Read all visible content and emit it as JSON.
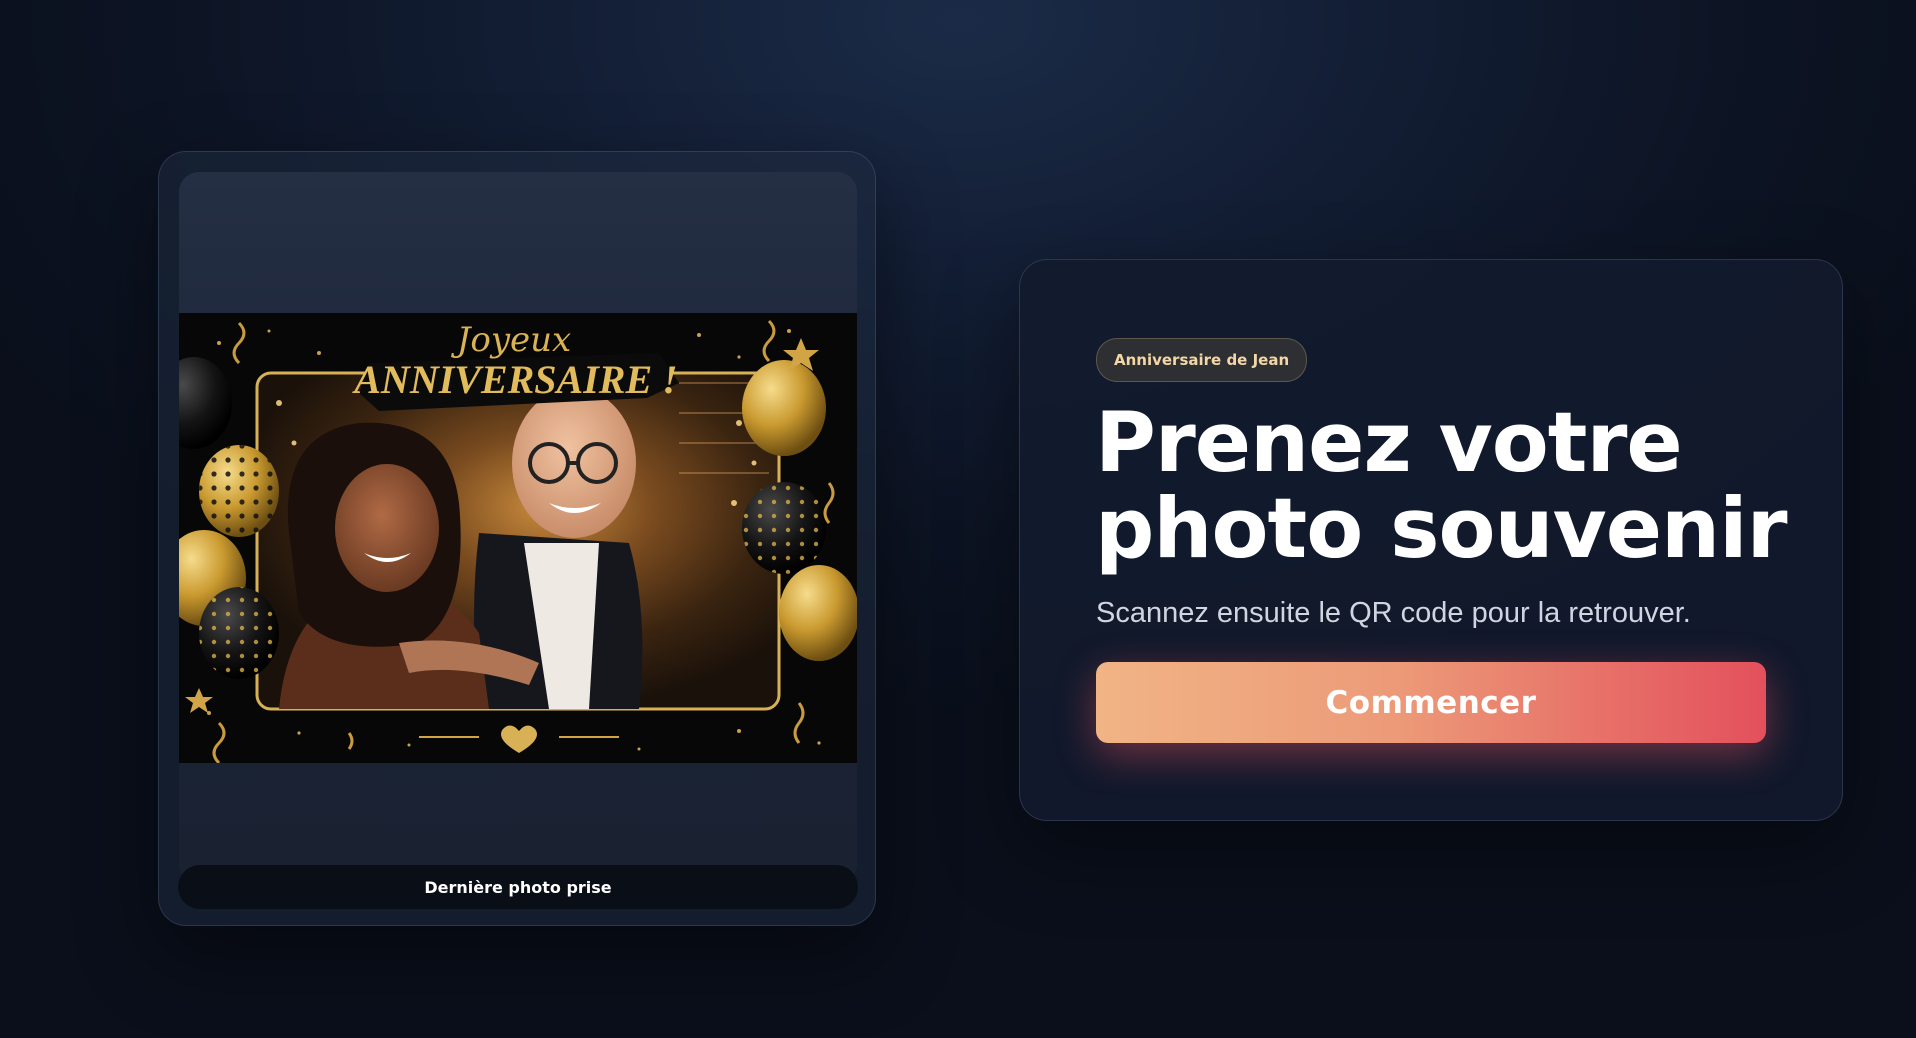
{
  "preview": {
    "photo_overlay_line1": "Joyeux",
    "photo_overlay_line2": "ANNIVERSAIRE !",
    "caption": "Dernière photo prise"
  },
  "intro": {
    "event_badge": "Anniversaire de Jean",
    "headline_line1": "Prenez votre",
    "headline_line2": "photo souvenir",
    "subtitle": "Scannez ensuite le QR code pour la retrouver.",
    "start_label": "Commencer"
  },
  "colors": {
    "background": "#0c1322",
    "card": "#121a2e",
    "badge_text": "#f3d7a6",
    "button_gradient_start": "#f1b485",
    "button_gradient_end": "#e3505c",
    "photo_frame_gold": "#d8b055"
  }
}
